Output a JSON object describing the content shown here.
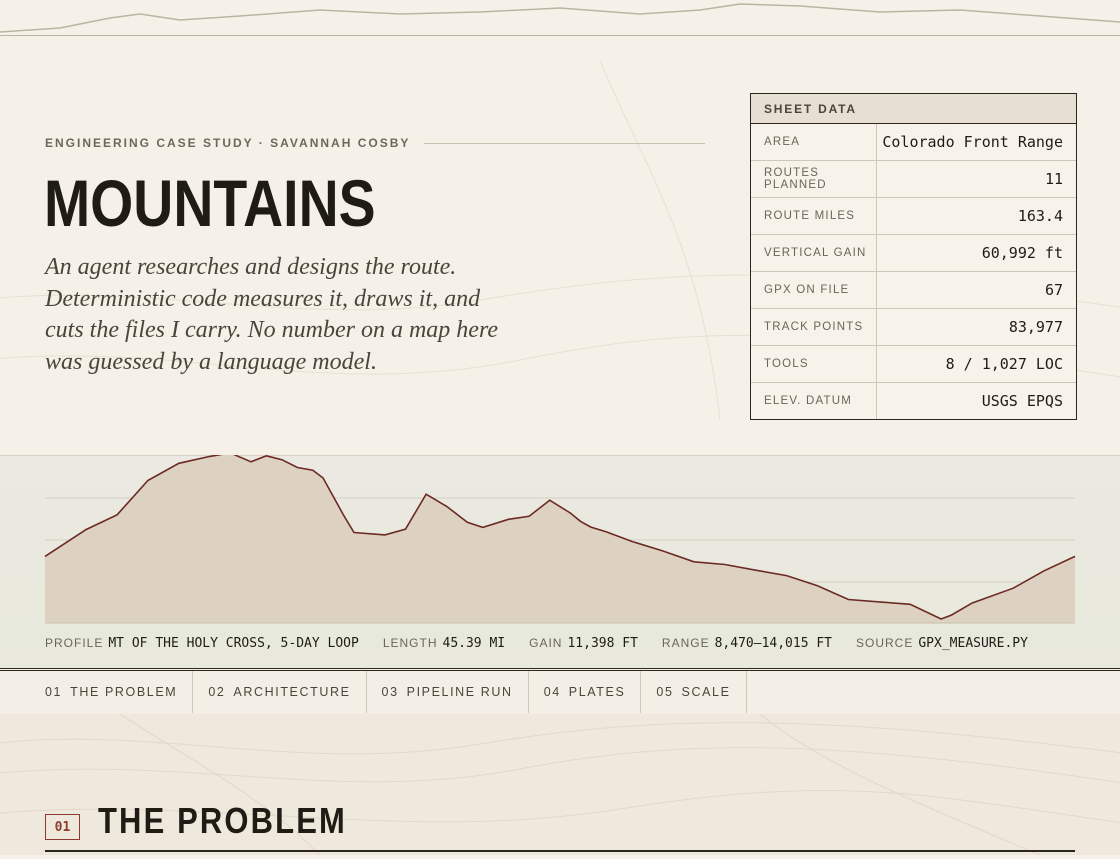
{
  "header": {
    "eyebrow": "ENGINEERING CASE STUDY · SAVANNAH COSBY",
    "title": "MOUNTAINS",
    "lede": "An agent researches and designs the route. Deterministic code measures it, draws it, and cuts the files I carry. No number on a map here was guessed by a language model."
  },
  "sheet": {
    "heading": "SHEET DATA",
    "rows": [
      {
        "key": "AREA",
        "value": "Colorado Front Range"
      },
      {
        "key": "ROUTES PLANNED",
        "value": "11"
      },
      {
        "key": "ROUTE MILES",
        "value": "163.4"
      },
      {
        "key": "VERTICAL GAIN",
        "value": "60,992 ft"
      },
      {
        "key": "GPX ON FILE",
        "value": "67"
      },
      {
        "key": "TRACK POINTS",
        "value": "83,977"
      },
      {
        "key": "TOOLS",
        "value": "8 / 1,027 LOC"
      },
      {
        "key": "ELEV. DATUM",
        "value": "USGS EPQS"
      }
    ]
  },
  "profile": {
    "caption": [
      {
        "key": "PROFILE",
        "value": "MT OF THE HOLY CROSS, 5-DAY LOOP"
      },
      {
        "key": "LENGTH",
        "value": "45.39 MI"
      },
      {
        "key": "GAIN",
        "value": "11,398 FT"
      },
      {
        "key": "RANGE",
        "value": "8,470–14,015 FT"
      },
      {
        "key": "SOURCE",
        "value": "GPX_MEASURE.PY"
      }
    ],
    "fill_color": "#ddd2c2",
    "line_color": "#6b2a24"
  },
  "chart_data": {
    "type": "area",
    "ylim": [
      8470,
      14015
    ],
    "x": [
      0,
      0.04,
      0.07,
      0.1,
      0.13,
      0.16,
      0.18,
      0.2,
      0.215,
      0.23,
      0.245,
      0.26,
      0.27,
      0.29,
      0.3,
      0.33,
      0.35,
      0.37,
      0.39,
      0.41,
      0.425,
      0.45,
      0.47,
      0.49,
      0.51,
      0.52,
      0.53,
      0.545,
      0.57,
      0.6,
      0.63,
      0.66,
      0.69,
      0.72,
      0.75,
      0.78,
      0.81,
      0.84,
      0.87,
      0.88,
      0.9,
      0.94,
      0.97,
      1.0
    ],
    "values": [
      10560,
      11460,
      11950,
      13100,
      13670,
      13900,
      14015,
      13720,
      13920,
      13790,
      13530,
      13440,
      13180,
      11930,
      11360,
      11280,
      11470,
      12640,
      12230,
      11700,
      11530,
      11800,
      11900,
      12440,
      12010,
      11730,
      11540,
      11380,
      11060,
      10740,
      10380,
      10290,
      10100,
      9920,
      9580,
      9120,
      9040,
      8960,
      8470,
      8600,
      9000,
      9500,
      10080,
      10560
    ]
  },
  "nav": [
    {
      "num": "01",
      "label": "THE PROBLEM"
    },
    {
      "num": "02",
      "label": "ARCHITECTURE"
    },
    {
      "num": "03",
      "label": "PIPELINE RUN"
    },
    {
      "num": "04",
      "label": "PLATES"
    },
    {
      "num": "05",
      "label": "SCALE"
    }
  ],
  "section": {
    "num": "01",
    "title": "THE PROBLEM"
  }
}
